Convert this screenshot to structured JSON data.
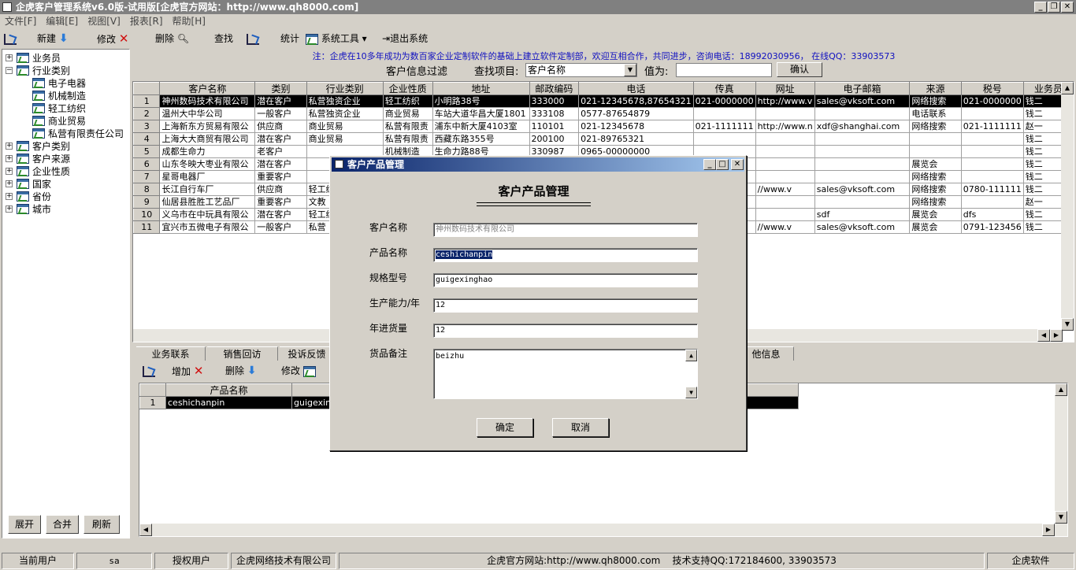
{
  "window": {
    "title": "企虎客户管理系统v6.0版-试用版[企虎官方网站：http://www.qh8000.com]",
    "min": "_",
    "max": "❐",
    "close": "✕"
  },
  "menu": [
    "文件[F]",
    "编辑[E]",
    "视图[V]",
    "报表[R]",
    "帮助[H]"
  ],
  "toolbar": {
    "new": "新建",
    "edit": "修改",
    "delete": "删除",
    "find": "查找",
    "stats": "统计",
    "tools": "系统工具",
    "exit": "退出系统"
  },
  "tree": [
    {
      "label": "业务员",
      "expand": "+",
      "level": 0
    },
    {
      "label": "行业类别",
      "expand": "−",
      "level": 0
    },
    {
      "label": "电子电器",
      "level": 1
    },
    {
      "label": "机械制造",
      "level": 1
    },
    {
      "label": "轻工纺织",
      "level": 1
    },
    {
      "label": "商业贸易",
      "level": 1
    },
    {
      "label": "私营有限责任公司",
      "level": 1
    },
    {
      "label": "客户类别",
      "expand": "+",
      "level": 0
    },
    {
      "label": "客户来源",
      "expand": "+",
      "level": 0
    },
    {
      "label": "企业性质",
      "expand": "+",
      "level": 0
    },
    {
      "label": "国家",
      "expand": "+",
      "level": 0
    },
    {
      "label": "省份",
      "expand": "+",
      "level": 0
    },
    {
      "label": "城市",
      "expand": "+",
      "level": 0
    }
  ],
  "left_buttons": {
    "expand": "展开",
    "collapse": "合并",
    "refresh": "刷新"
  },
  "notice": "注：企虎在10多年成功为数百家企业定制软件的基础上建立软件定制部，欢迎互相合作，共同进步，咨询电话：18992030956，  在线QQ：33903573",
  "filter": {
    "title": "客户信息过滤",
    "field_label": "查找项目:",
    "field_value": "客户名称",
    "value_label": "值为:",
    "value": "",
    "confirm": "确认"
  },
  "grid": {
    "columns": [
      "",
      "客户名称",
      "类别",
      "行业类别",
      "企业性质",
      "地址",
      "邮政编码",
      "电话",
      "传真",
      "网址",
      "电子邮箱",
      "来源",
      "税号",
      "业务员"
    ],
    "rows": [
      [
        "1",
        "神州数码技术有限公司",
        "潜在客户",
        "私营独资企业",
        "轻工纺织",
        "小明路38号",
        "333000",
        "021-12345678,87654321",
        "021-0000000",
        "http://www.v",
        "sales@vksoft.com",
        "网络搜索",
        "021-0000000",
        "钱二"
      ],
      [
        "2",
        "温州大中华公司",
        "一般客户",
        "私营独资企业",
        "商业贸易",
        "车站大道华昌大厦1801",
        "333108",
        "0577-87654879",
        "",
        "",
        "",
        "电话联系",
        "",
        "钱二"
      ],
      [
        "3",
        "上海新东方贸易有限公",
        "供应商",
        "商业贸易",
        "私营有限责",
        "浦东中新大厦4103室",
        "110101",
        "021-12345678",
        "021-1111111",
        "http://www.n",
        "xdf@shanghai.com",
        "网络搜索",
        "021-1111111",
        "赵一"
      ],
      [
        "4",
        "上海大大商贸有限公司",
        "潜在客户",
        "商业贸易",
        "私营有限责",
        "西藏东路355号",
        "200100",
        "021-89765321",
        "",
        "",
        "",
        "",
        "",
        "钱二"
      ],
      [
        "5",
        "成都生命力",
        "老客户",
        "",
        "机械制造",
        "生命力路88号",
        "330987",
        "0965-00000000",
        "",
        "",
        "",
        "",
        "",
        "钱二"
      ],
      [
        "6",
        "山东冬映大枣业有限公",
        "潜在客户",
        "",
        "",
        "",
        "",
        "",
        "",
        "",
        "",
        "展览会",
        "",
        "钱二"
      ],
      [
        "7",
        "星哥电器厂",
        "重要客户",
        "",
        "",
        "",
        "",
        "",
        "",
        "",
        "",
        "网络搜索",
        "",
        "钱二"
      ],
      [
        "8",
        "长江自行车厂",
        "供应商",
        "轻工纺",
        "",
        "",
        "",
        "",
        "",
        "//www.v",
        "sales@vksoft.com",
        "网络搜索",
        "0780-111111",
        "钱二"
      ],
      [
        "9",
        "仙居县胜胜工艺品厂",
        "重要客户",
        "文教",
        "",
        "",
        "",
        "",
        "",
        "",
        "",
        "网络搜索",
        "",
        "赵一"
      ],
      [
        "10",
        "义乌市在中玩具有限公",
        "潜在客户",
        "轻工纺",
        "",
        "",
        "",
        "",
        "",
        "",
        "sdf",
        "展览会",
        "dfs",
        "钱二"
      ],
      [
        "11",
        "宜兴市五微电子有限公",
        "一般客户",
        "私营",
        "",
        "",
        "",
        "",
        "",
        "//www.v",
        "sales@vksoft.com",
        "展览会",
        "0791-123456",
        "钱二"
      ]
    ]
  },
  "tabs": [
    "业务联系",
    "销售回访",
    "投诉反馈",
    "他信息"
  ],
  "sub_toolbar": {
    "add": "增加",
    "delete": "删除",
    "edit": "修改"
  },
  "sub_grid": {
    "columns": [
      "",
      "产品名称",
      ""
    ],
    "rows": [
      [
        "1",
        "ceshichanpin",
        "guigexing"
      ]
    ]
  },
  "dialog": {
    "title": "客户产品管理",
    "heading": "客户产品管理",
    "fields": [
      {
        "label": "客户名称",
        "value": "神州数码技术有限公司"
      },
      {
        "label": "产品名称",
        "value": "ceshichanpin"
      },
      {
        "label": "规格型号",
        "value": "guigexinghao"
      },
      {
        "label": "生产能力/年",
        "value": "12"
      },
      {
        "label": "年进货量",
        "value": "12"
      }
    ],
    "remark_label": "货品备注",
    "remark_value": "beizhu",
    "ok": "确定",
    "cancel": "取消"
  },
  "status": {
    "current_user_label": "当前用户",
    "current_user": "sa",
    "licensed_label": "授权用户",
    "licensed": "企虎网络技术有限公司",
    "website": "企虎官方网站:http://www.qh8000.com",
    "support": "技术支持QQ:172184600, 33903573",
    "brand": "企虎软件"
  }
}
